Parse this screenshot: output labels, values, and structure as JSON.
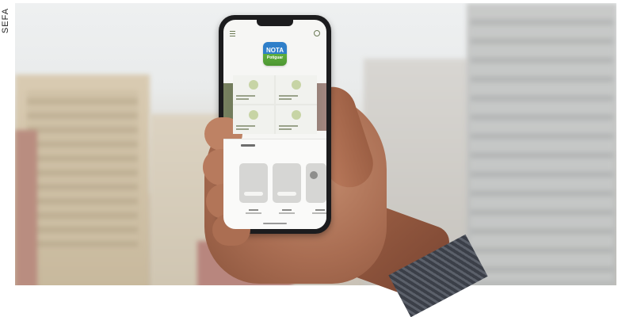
{
  "side_label": "SEFA",
  "app": {
    "logo_line1": "NOTA",
    "logo_line2": "Potiguar"
  }
}
